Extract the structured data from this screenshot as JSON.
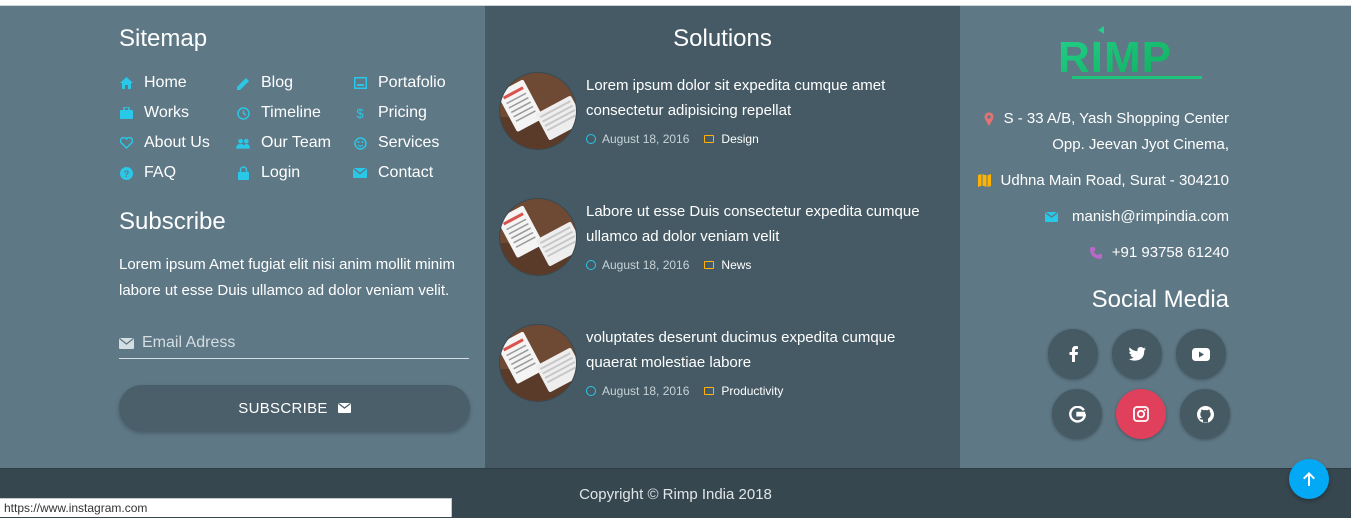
{
  "sitemap": {
    "title": "Sitemap",
    "items": [
      {
        "label": "Home",
        "icon": "home-icon"
      },
      {
        "label": "Blog",
        "icon": "pencil-icon"
      },
      {
        "label": "Portafolio",
        "icon": "image-icon"
      },
      {
        "label": "Works",
        "icon": "briefcase-icon"
      },
      {
        "label": "Timeline",
        "icon": "clock-icon"
      },
      {
        "label": "Pricing",
        "icon": "dollar-icon"
      },
      {
        "label": "About Us",
        "icon": "heart-icon"
      },
      {
        "label": "Our Team",
        "icon": "people-icon"
      },
      {
        "label": "Services",
        "icon": "smile-icon"
      },
      {
        "label": "FAQ",
        "icon": "help-icon"
      },
      {
        "label": "Login",
        "icon": "lock-icon"
      },
      {
        "label": "Contact",
        "icon": "mail-icon"
      }
    ]
  },
  "subscribe": {
    "title": "Subscribe",
    "text": "Lorem ipsum Amet fugiat elit nisi anim mollit minim labore ut esse Duis ullamco ad dolor veniam velit.",
    "email_placeholder": "Email Adress",
    "button_label": "SUBSCRIBE"
  },
  "solutions": {
    "title": "Solutions",
    "posts": [
      {
        "title": "Lorem ipsum dolor sit expedita cumque amet consectetur adipisicing repellat",
        "date": "August 18, 2016",
        "category": "Design"
      },
      {
        "title": "Labore ut esse Duis consectetur expedita cumque ullamco ad dolor veniam velit",
        "date": "August 18, 2016",
        "category": "News"
      },
      {
        "title": "voluptates deserunt ducimus expedita cumque quaerat molestiae labore",
        "date": "August 18, 2016",
        "category": "Productivity"
      }
    ]
  },
  "contact": {
    "logo_text": "RIMP",
    "address_line1": "S - 33 A/B, Yash Shopping Center",
    "address_line2": "Opp. Jeevan Jyot Cinema,",
    "address_line3": "Udhna Main Road, Surat - 304210",
    "email": "manish@rimpindia.com",
    "phone": "+91 93758 61240"
  },
  "social": {
    "title": "Social Media",
    "networks": [
      "facebook-icon",
      "twitter-icon",
      "youtube-icon",
      "google-icon",
      "instagram-icon",
      "github-icon"
    ]
  },
  "footer": {
    "copyright": "Copyright © Rimp India 2018"
  },
  "status_bar": {
    "url": "https://www.instagram.com"
  },
  "colors": {
    "panel": "#5e7886",
    "panel_dark": "#455a64",
    "bottom_bar": "#37474f",
    "accent_cyan": "#29c7e8",
    "accent_orange": "#ffb300",
    "instagram": "#e1405c",
    "to_top": "#03a9f4"
  }
}
